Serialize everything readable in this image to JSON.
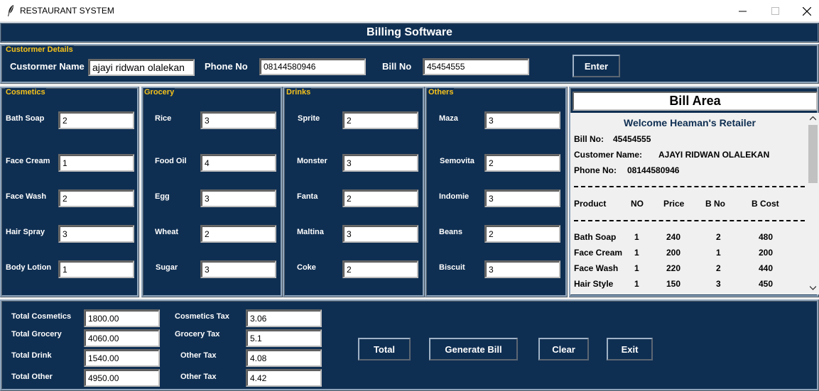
{
  "window": {
    "title": "RESTAURANT SYSTEM"
  },
  "header": {
    "title": "Billing Software"
  },
  "customer": {
    "legend": "Custormer Details",
    "name_label": "Custormer Name",
    "name_value": "ajayi ridwan olalekan",
    "phone_label": "Phone No",
    "phone_value": "08144580946",
    "bill_label": "Bill No",
    "bill_value": "45454555",
    "enter_label": "Enter"
  },
  "categories": [
    {
      "legend": "Cosmetics",
      "items": [
        {
          "label": "Bath Soap",
          "value": "2"
        },
        {
          "label": "Face Cream",
          "value": "1"
        },
        {
          "label": "Face Wash",
          "value": "2"
        },
        {
          "label": "Hair Spray",
          "value": "3"
        },
        {
          "label": "Body Lotion",
          "value": "1"
        }
      ]
    },
    {
      "legend": "Grocery",
      "items": [
        {
          "label": "Rice",
          "value": "3"
        },
        {
          "label": "Food Oil",
          "value": "4"
        },
        {
          "label": "Egg",
          "value": "3"
        },
        {
          "label": "Wheat",
          "value": "2"
        },
        {
          "label": "Sugar",
          "value": "3"
        }
      ]
    },
    {
      "legend": "Drinks",
      "items": [
        {
          "label": "Sprite",
          "value": "2"
        },
        {
          "label": "Monster",
          "value": "3"
        },
        {
          "label": "Fanta",
          "value": "2"
        },
        {
          "label": "Maltina",
          "value": "3"
        },
        {
          "label": "Coke",
          "value": "2"
        }
      ]
    },
    {
      "legend": "Others",
      "items": [
        {
          "label": "Maza",
          "value": "3"
        },
        {
          "label": "Semovita",
          "value": "2"
        },
        {
          "label": "Indomie",
          "value": "3"
        },
        {
          "label": "Beans",
          "value": "2"
        },
        {
          "label": "Biscuit",
          "value": "3"
        }
      ]
    }
  ],
  "bill": {
    "title": "Bill Area",
    "welcome": "Welcome Heaman's Retailer",
    "bill_no_label": "Bill No:",
    "bill_no_value": "45454555",
    "customer_label": "Customer Name:",
    "customer_value": "AJAYI RIDWAN OLALEKAN",
    "phone_label": "Phone No:",
    "phone_value": "08144580946",
    "columns": [
      "Product",
      "NO",
      "Price",
      "B No",
      "B Cost"
    ],
    "rows": [
      [
        "Bath Soap",
        "1",
        "240",
        "2",
        "480"
      ],
      [
        "Face Cream",
        "1",
        "200",
        "1",
        "200"
      ],
      [
        "Face Wash",
        "1",
        "220",
        "2",
        "440"
      ],
      [
        "Hair Style",
        "1",
        "150",
        "3",
        "450"
      ]
    ]
  },
  "totals": {
    "total_cosmetics_label": "Total Cosmetics",
    "total_cosmetics_value": "1800.00",
    "total_grocery_label": "Total Grocery",
    "total_grocery_value": "4060.00",
    "total_drink_label": "Total Drink",
    "total_drink_value": "1540.00",
    "total_other_label": "Total Other",
    "total_other_value": "4950.00",
    "cosmetics_tax_label": "Cosmetics Tax",
    "cosmetics_tax_value": "3.06",
    "grocery_tax_label": "Grocery Tax",
    "grocery_tax_value": "5.1",
    "other_tax_1_label": "Other Tax",
    "other_tax_1_value": "4.08",
    "other_tax_2_label": "Other Tax",
    "other_tax_2_value": "4.42"
  },
  "buttons": {
    "total": "Total",
    "generate_bill": "Generate Bill",
    "clear": "Clear",
    "exit": "Exit"
  },
  "colors": {
    "panel": "#0f2f52",
    "legend": "#f6c21a",
    "welcome": "#0f2f52"
  },
  "icons": {
    "app": "feather-icon",
    "minimize": "minimize-icon",
    "maximize": "maximize-icon",
    "close": "close-icon"
  }
}
